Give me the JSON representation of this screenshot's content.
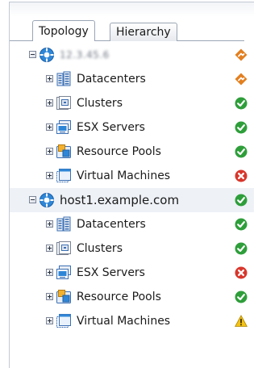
{
  "tabs": [
    {
      "label": "Topology",
      "active": true
    },
    {
      "label": "Hierarchy",
      "active": false
    }
  ],
  "tree": [
    {
      "level": 0,
      "expanded": true,
      "icon": "host-icon",
      "label": "12.3.45.6",
      "blurred": true,
      "status": "warning-diamond",
      "selected": false
    },
    {
      "level": 1,
      "expanded": false,
      "icon": "datacenter-icon",
      "label": "Datacenters",
      "status": "warning-diamond"
    },
    {
      "level": 1,
      "expanded": false,
      "icon": "cluster-icon",
      "label": "Clusters",
      "status": "ok"
    },
    {
      "level": 1,
      "expanded": false,
      "icon": "esx-server-icon",
      "label": "ESX Servers",
      "status": "ok"
    },
    {
      "level": 1,
      "expanded": false,
      "icon": "resource-pool-icon",
      "label": "Resource Pools",
      "status": "ok"
    },
    {
      "level": 1,
      "expanded": false,
      "icon": "virtual-machine-icon",
      "label": "Virtual Machines",
      "status": "error"
    },
    {
      "level": 0,
      "expanded": true,
      "icon": "host-icon",
      "label": "host1.example.com",
      "blurred": false,
      "status": "ok",
      "selected": true
    },
    {
      "level": 1,
      "expanded": false,
      "icon": "datacenter-icon",
      "label": "Datacenters",
      "status": "ok"
    },
    {
      "level": 1,
      "expanded": false,
      "icon": "cluster-icon",
      "label": "Clusters",
      "status": "ok"
    },
    {
      "level": 1,
      "expanded": false,
      "icon": "esx-server-icon",
      "label": "ESX Servers",
      "status": "error"
    },
    {
      "level": 1,
      "expanded": false,
      "icon": "resource-pool-icon",
      "label": "Resource Pools",
      "status": "ok"
    },
    {
      "level": 1,
      "expanded": false,
      "icon": "virtual-machine-icon",
      "label": "Virtual Machines",
      "status": "warning-triangle"
    }
  ],
  "status_colors": {
    "ok": "#2e9e3a",
    "error": "#d8362b",
    "warning-diamond": "#e37f1f",
    "warning-triangle": "#f3c316"
  }
}
